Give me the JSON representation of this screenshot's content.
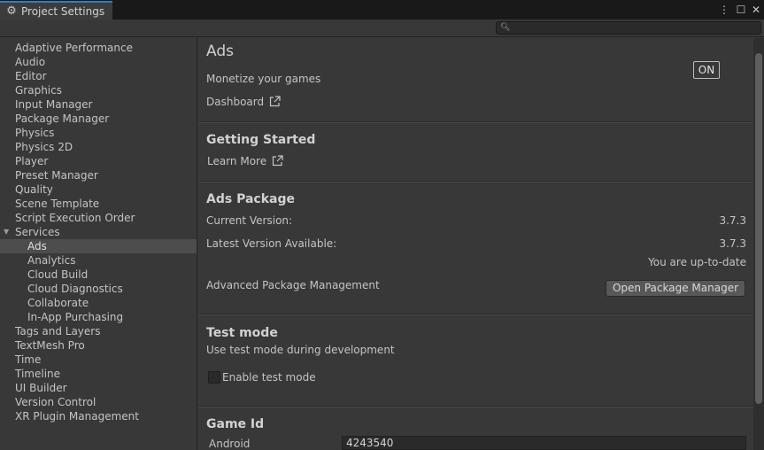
{
  "window": {
    "tab_title": "Project Settings",
    "tab_icon": "gear-icon",
    "menu_glyph": "⋮",
    "maximize_glyph": "☐",
    "close_glyph": "✕"
  },
  "search": {
    "placeholder": "",
    "value": ""
  },
  "sidebar": {
    "items": [
      {
        "label": "Adaptive Performance"
      },
      {
        "label": "Audio"
      },
      {
        "label": "Editor"
      },
      {
        "label": "Graphics"
      },
      {
        "label": "Input Manager"
      },
      {
        "label": "Package Manager"
      },
      {
        "label": "Physics"
      },
      {
        "label": "Physics 2D"
      },
      {
        "label": "Player"
      },
      {
        "label": "Preset Manager"
      },
      {
        "label": "Quality"
      },
      {
        "label": "Scene Template"
      },
      {
        "label": "Script Execution Order"
      },
      {
        "label": "Services",
        "expanded": true
      },
      {
        "label": "Ads",
        "selected": true
      },
      {
        "label": "Analytics"
      },
      {
        "label": "Cloud Build"
      },
      {
        "label": "Cloud Diagnostics"
      },
      {
        "label": "Collaborate"
      },
      {
        "label": "In-App Purchasing"
      },
      {
        "label": "Tags and Layers"
      },
      {
        "label": "TextMesh Pro"
      },
      {
        "label": "Time"
      },
      {
        "label": "Timeline"
      },
      {
        "label": "UI Builder"
      },
      {
        "label": "Version Control"
      },
      {
        "label": "XR Plugin Management"
      }
    ]
  },
  "ads": {
    "title": "Ads",
    "subtitle": "Monetize your games",
    "toggle_label": "ON",
    "dashboard_link": "Dashboard"
  },
  "getting_started": {
    "title": "Getting Started",
    "learn_more_link": "Learn More"
  },
  "ads_package": {
    "title": "Ads Package",
    "current_version_label": "Current Version:",
    "current_version_value": "3.7.3",
    "latest_version_label": "Latest Version Available:",
    "latest_version_value": "3.7.3",
    "status": "You are up-to-date",
    "advanced_label": "Advanced Package Management",
    "open_pm_button": "Open Package Manager"
  },
  "test_mode": {
    "title": "Test mode",
    "description": "Use test mode during development",
    "checkbox_label": "Enable test mode",
    "checked": false
  },
  "game_id": {
    "title": "Game Id",
    "android_label": "Android",
    "android_value": "4243540"
  },
  "colors": {
    "background": "#383838",
    "titlebar": "#191919",
    "tab_accent": "#3a79bb",
    "selected_row": "#4d4d4d",
    "field": "#2a2a2a"
  }
}
